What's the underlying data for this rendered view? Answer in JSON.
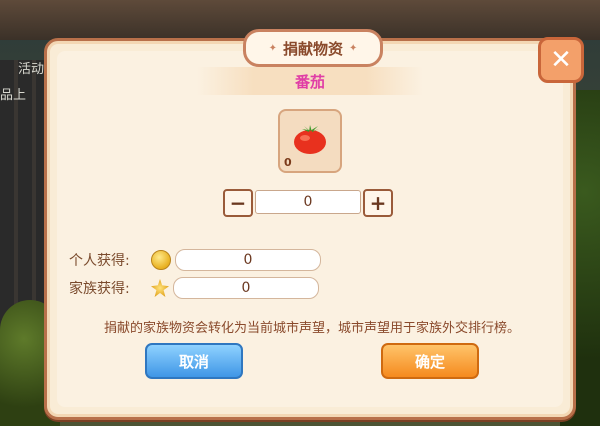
{
  "background": {
    "side_text_top": "活动",
    "side_text_bottom": "品上"
  },
  "dialog": {
    "title": "捐献物资",
    "close_icon": "close-x-icon"
  },
  "item": {
    "name": "番茄",
    "icon": "tomato-icon",
    "owned_count": "0"
  },
  "stepper": {
    "minus_label": "−",
    "plus_label": "+",
    "value": "0"
  },
  "rewards": [
    {
      "label": "个人获得:",
      "icon": "gold-coin-icon",
      "value": "0"
    },
    {
      "label": "家族获得:",
      "icon": "family-badge-icon",
      "value": "0"
    }
  ],
  "description": "捐献的家族物资会转化为当前城市声望，城市声望用于家族外交排行榜。",
  "buttons": {
    "cancel": "取消",
    "confirm": "确定"
  },
  "colors": {
    "dialog_border": "#b8704a",
    "item_name": "#e03ea6",
    "cancel_blue": "#3f96e6",
    "confirm_orange": "#f58a1e",
    "text_brown": "#8a4a2c"
  }
}
